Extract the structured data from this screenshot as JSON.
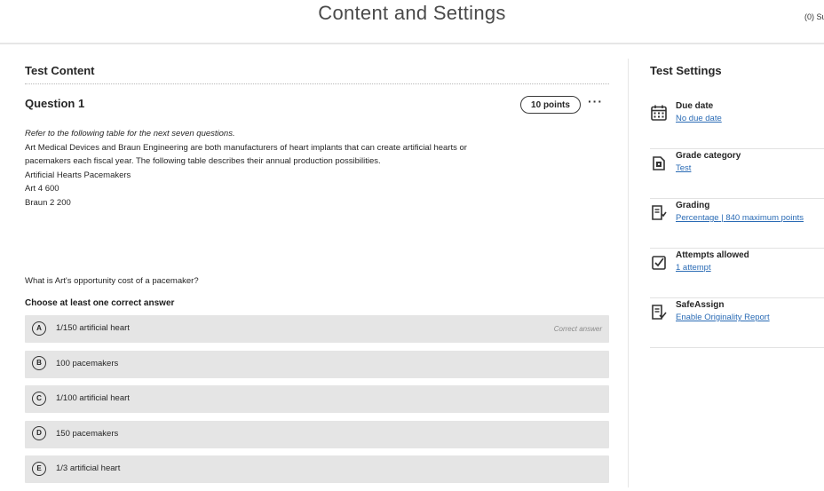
{
  "header": {
    "title": "Content and Settings",
    "submissions": "(0) Su"
  },
  "content": {
    "section_title": "Test Content",
    "question": {
      "title": "Question 1",
      "points": "10 points",
      "more": "···",
      "body": {
        "instruction": "Refer to the following table for the next seven questions.",
        "line1": "Art Medical Devices and Braun Engineering are both manufacturers of heart implants that can create artificial hearts or",
        "line2": "pacemakers each fiscal year. The following table describes their annual production possibilities.",
        "line3": "Artificial Hearts Pacemakers",
        "line4": "Art 4 600",
        "line5": "Braun 2 200"
      },
      "prompt": "What is Art's opportunity cost of a pacemaker?",
      "choose_label": "Choose at least one correct answer",
      "answers": [
        {
          "letter": "A",
          "text": "1/150 artificial heart",
          "tag": "Correct answer"
        },
        {
          "letter": "B",
          "text": "100 pacemakers"
        },
        {
          "letter": "C",
          "text": "1/100 artificial heart"
        },
        {
          "letter": "D",
          "text": "150 pacemakers"
        },
        {
          "letter": "E",
          "text": "1/3 artificial heart"
        }
      ]
    }
  },
  "settings": {
    "title": "Test Settings",
    "items": [
      {
        "label": "Due date",
        "link": "No due date",
        "icon": "calendar-icon"
      },
      {
        "label": "Grade category",
        "link": "Test",
        "icon": "gradebook-icon"
      },
      {
        "label": "Grading",
        "link_a": "Percentage",
        "sep": "|",
        "link_b": "840 maximum points",
        "icon": "grading-icon"
      },
      {
        "label": "Attempts allowed",
        "link": "1 attempt",
        "icon": "checkbox-icon"
      },
      {
        "label": "SafeAssign",
        "link": "Enable Originality Report",
        "icon": "safeassign-icon"
      }
    ]
  }
}
